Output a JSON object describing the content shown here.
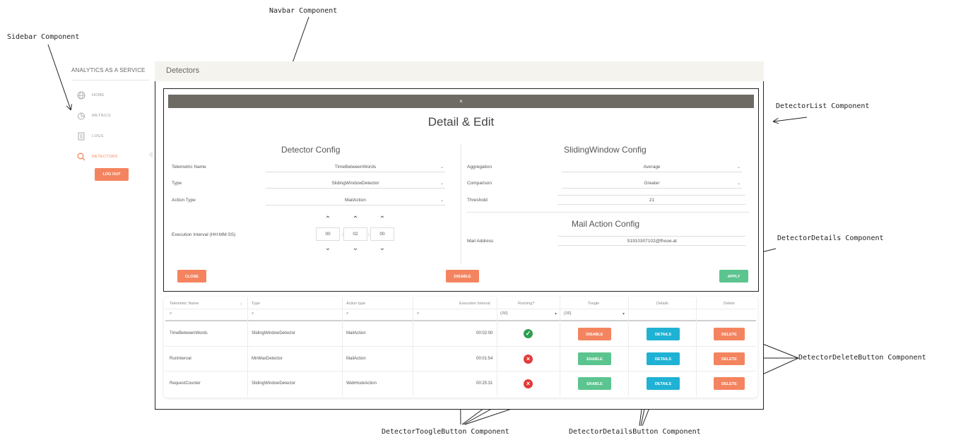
{
  "annotations": {
    "navbar": "Navbar Component",
    "sidebar": "Sidebar Component",
    "detector_list": "DetectorList Component",
    "detector_details": "DetectorDetails Component",
    "delete_button": "DetectorDeleteButton Component",
    "toggle_button": "DetectorToogleButton Component",
    "details_button": "DetectorDetailsButton Component"
  },
  "sidebar": {
    "title": "ANALYTICS AS A SERVICE",
    "items": [
      {
        "label": "HOME",
        "icon": "globe-icon"
      },
      {
        "label": "METRICS",
        "icon": "pie-chart-icon"
      },
      {
        "label": "LOGS",
        "icon": "document-icon"
      },
      {
        "label": "DETECTORS",
        "icon": "search-icon",
        "active": true
      }
    ],
    "logout": "LOG OUT"
  },
  "navbar": {
    "title": "Detectors"
  },
  "modal": {
    "close_x": "×",
    "title": "Detail & Edit",
    "detector_config": {
      "title": "Detector Config",
      "telemetric_label": "Telemetric Name",
      "telemetric_value": "TimeBetweenWords",
      "type_label": "Type",
      "type_value": "SlidingWindowDetector",
      "action_label": "Action Type",
      "action_value": "MailAction",
      "interval_label": "Execution Interval (HH:MM:SS)",
      "hh": "00",
      "mm": "02",
      "ss": "00"
    },
    "sliding_config": {
      "title": "SlidingWindow Config",
      "aggregation_label": "Aggregation",
      "aggregation_value": "Average",
      "comparison_label": "Comparison",
      "comparison_value": "Greater",
      "threshold_label": "Threshold",
      "threshold_value": "21"
    },
    "mail_config": {
      "title": "Mail Action Config",
      "address_label": "Mail Address",
      "address_value": "S1910307102@fhooe.at"
    },
    "close_btn": "CLOSE",
    "disable_btn": "DISABLE",
    "apply_btn": "APPLY"
  },
  "grid": {
    "headers": [
      "Telemetric Name",
      "Type",
      "Action type",
      "Execution Interval",
      "Running?",
      "Toogle",
      "Details",
      "Delete"
    ],
    "filter_all": "(All)",
    "rows": [
      {
        "name": "TimeBetweenWords",
        "type": "SlidingWindowDetector",
        "action": "MailAction",
        "interval": "00:02:00",
        "running": true,
        "toggle": "DISABLE"
      },
      {
        "name": "RunInterval",
        "type": "MinMaxDetector",
        "action": "MailAction",
        "interval": "00:01:54",
        "running": false,
        "toggle": "ENABLE"
      },
      {
        "name": "RequestCounter",
        "type": "SlidingWindowDetector",
        "action": "WebHookAction",
        "interval": "00:25:31",
        "running": false,
        "toggle": "ENABLE"
      }
    ],
    "details_btn": "DETAILS",
    "delete_btn": "DELETE"
  }
}
